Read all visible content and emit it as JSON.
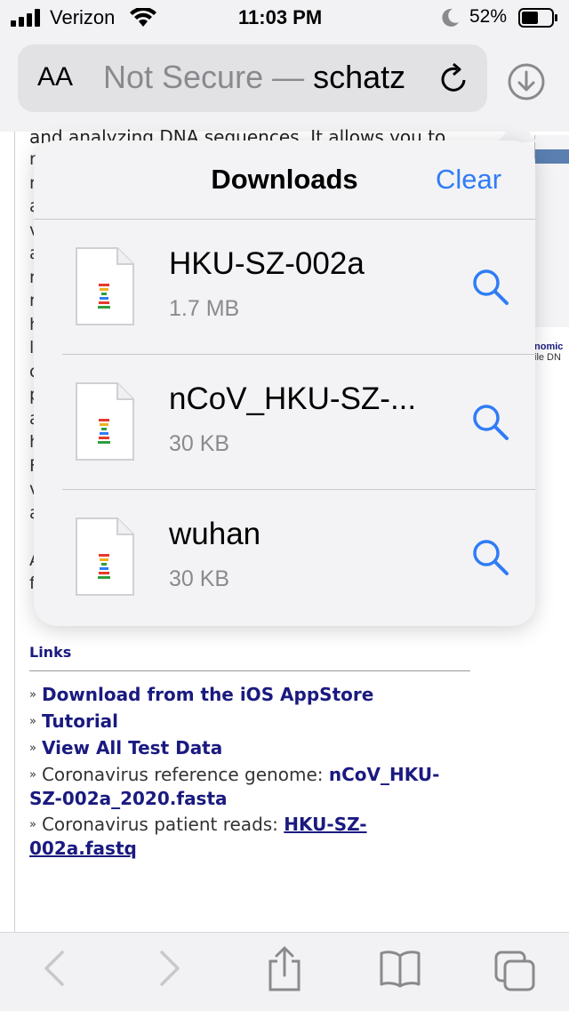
{
  "status": {
    "carrier": "Verizon",
    "time": "11:03 PM",
    "battery": "52%"
  },
  "toolbar": {
    "aa": "AA",
    "url_prefix": "Not Secure — ",
    "url_host": "schatz"
  },
  "downloads": {
    "title": "Downloads",
    "clear": "Clear",
    "items": [
      {
        "name": "HKU-SZ-002a",
        "size": "1.7 MB"
      },
      {
        "name": "nCoV_HKU-SZ-...",
        "size": "30 KB"
      },
      {
        "name": "wuhan",
        "size": "30 KB"
      }
    ]
  },
  "page": {
    "top_line": "and analyzing DNA sequences. It allows you to",
    "left_chars": [
      "r",
      "r",
      "a",
      "v",
      "a",
      "r",
      "r",
      "h",
      "l",
      "c",
      "p",
      "a",
      "h",
      "F",
      "v",
      "a",
      "",
      "A",
      "f"
    ],
    "right_heading": "nomic",
    "right_sub": "ile DN",
    "links_heading": "Links",
    "links": [
      {
        "bold": "Download from the iOS AppStore"
      },
      {
        "bold": "Tutorial"
      },
      {
        "bold": "View All Test Data"
      },
      {
        "text": "Coronavirus reference genome: ",
        "link": "nCoV_HKU-SZ-002a_2020.fasta"
      },
      {
        "text": "Coronavirus patient reads: ",
        "link": "HKU-SZ-002a.fastq"
      }
    ]
  },
  "colors": {
    "accent": "#2f7cf6",
    "link": "#1a1a80"
  },
  "icons": [
    "signal-icon",
    "wifi-icon",
    "moon-icon",
    "battery-icon",
    "reload-icon",
    "download-icon",
    "file-icon",
    "magnifier-icon",
    "back-icon",
    "forward-icon",
    "share-icon",
    "bookmarks-icon",
    "tabs-icon"
  ]
}
